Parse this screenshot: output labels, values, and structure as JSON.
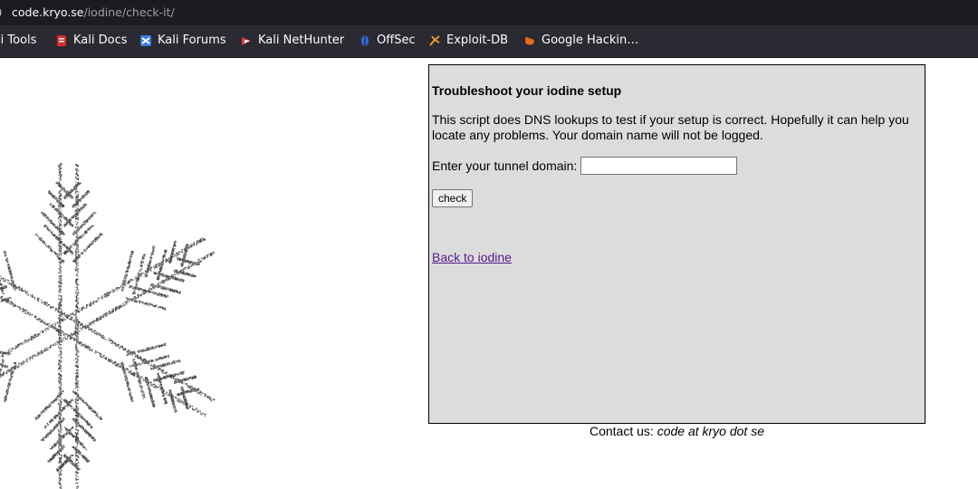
{
  "browser": {
    "url_host": "code.kryo.se",
    "url_path": "/iodine/check-it/",
    "bookmarks": [
      {
        "label": "li Tools",
        "icon": "kali-tools-icon"
      },
      {
        "label": "Kali Docs",
        "icon": "kali-docs-icon"
      },
      {
        "label": "Kali Forums",
        "icon": "kali-forums-icon"
      },
      {
        "label": "Kali NetHunter",
        "icon": "kali-nethunter-icon"
      },
      {
        "label": "OffSec",
        "icon": "offsec-icon"
      },
      {
        "label": "Exploit-DB",
        "icon": "exploit-db-icon"
      },
      {
        "label": "Google Hackin…",
        "icon": "google-hacking-icon"
      }
    ]
  },
  "page": {
    "heading": "Troubleshoot your iodine setup",
    "description": "This script does DNS lookups to test if your setup is correct. Hopefully it can help you locate any problems. Your domain name will not be logged.",
    "domain_label": "Enter your tunnel domain:",
    "domain_value": "",
    "check_label": "check",
    "back_link": "Back to iodine",
    "contact_prefix": "Contact us:",
    "contact_email": "code at kryo dot se"
  },
  "colors": {
    "box_bg": "#dcdcdc",
    "visited_link": "#551a8b",
    "toolbar_bg": "#2b2a33",
    "urlbar_bg": "#1c1b22"
  }
}
